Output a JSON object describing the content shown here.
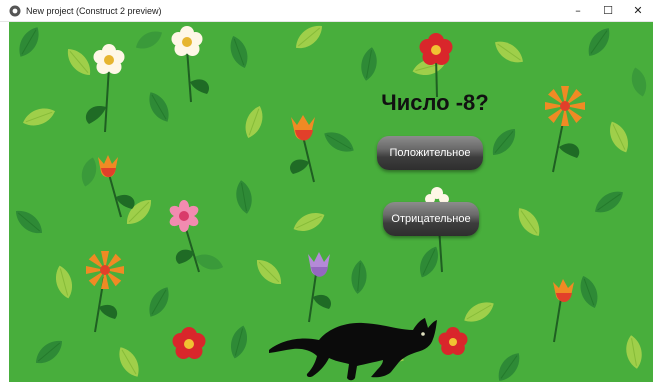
{
  "window": {
    "title": "New project (Construct 2 preview)",
    "minimize_glyph": "–",
    "maximize_glyph": "☐",
    "close_glyph": "✕"
  },
  "game": {
    "question_text": "Число -8?",
    "positive_label": "Положительное",
    "negative_label": "Отрицательное"
  },
  "icons": {
    "app": "construct-logo-icon",
    "cat": "black-cat-sprite"
  },
  "colors": {
    "background_green": "#48ae3c",
    "leaf_dark": "#2e8a36",
    "leaf_light": "#9fcf4a",
    "button_dark": "#3d3d3d",
    "question_text": "#111111"
  }
}
